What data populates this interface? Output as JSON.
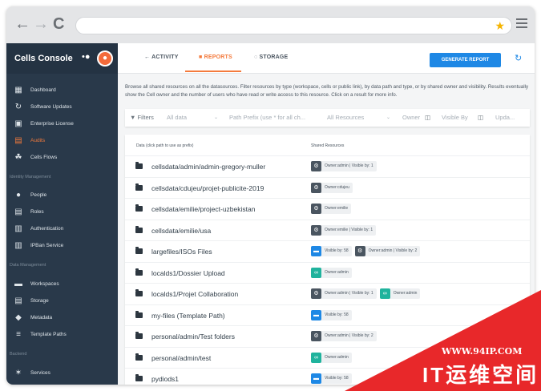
{
  "browser": {
    "back_icon": "arrow-left-icon",
    "forward_icon": "arrow-right-icon",
    "reload_icon": "reload-icon",
    "address_value": "",
    "star_icon": "star-icon",
    "menu_icon": "hamburger-icon",
    "back_glyph": "←",
    "forward_glyph": "→",
    "reload_glyph": "C",
    "star_glyph": "★"
  },
  "brand": {
    "name": "Cells Console",
    "dot": "•●"
  },
  "sidebar": {
    "items_top": [
      {
        "label": "Dashboard",
        "icon": "dashboard-icon",
        "glyph": "▦"
      },
      {
        "label": "Software Updates",
        "icon": "update-icon",
        "glyph": "↻"
      },
      {
        "label": "Enterprise License",
        "icon": "license-icon",
        "glyph": "▣"
      },
      {
        "label": "Audits",
        "icon": "audit-icon",
        "glyph": "▤",
        "active": true
      },
      {
        "label": "Cells Flows",
        "icon": "flows-icon",
        "glyph": "☘"
      }
    ],
    "section_identity": "Identity Management",
    "items_identity": [
      {
        "label": "People",
        "icon": "person-icon",
        "glyph": "●"
      },
      {
        "label": "Roles",
        "icon": "roles-icon",
        "glyph": "▤"
      },
      {
        "label": "Authentication",
        "icon": "authentication-icon",
        "glyph": "▥"
      },
      {
        "label": "IPBan Service",
        "icon": "ipban-icon",
        "glyph": "▥"
      }
    ],
    "section_data": "Data Management",
    "items_data": [
      {
        "label": "Workspaces",
        "icon": "folder-icon",
        "glyph": "▬"
      },
      {
        "label": "Storage",
        "icon": "storage-icon",
        "glyph": "▤"
      },
      {
        "label": "Metadata",
        "icon": "tag-icon",
        "glyph": "◆"
      },
      {
        "label": "Template Paths",
        "icon": "tree-icon",
        "glyph": "≡"
      }
    ],
    "section_backend": "Backend",
    "items_backend": [
      {
        "label": "Services",
        "icon": "services-icon",
        "glyph": "✶"
      }
    ]
  },
  "tabs": [
    {
      "label": "←  ACTIVITY",
      "active": false
    },
    {
      "label": "■  REPORTS",
      "active": true
    },
    {
      "label": "◌  STORAGE",
      "active": false
    }
  ],
  "generate_button": "GENERATE REPORT",
  "refresh_glyph": "↻",
  "description": "Browse all shared resources on all the datasources. Filter resources by type (workspace, cells or public link), by data path and type, or by shared owner and visibility. Results eventually show the Cell owner and the number of users who have read or write access to this resource. Click on a result for more info.",
  "filters": {
    "label": "▼ Filters",
    "data_select": "All data",
    "path_placeholder": "Path Prefix (use * for all ch...",
    "resources_select": "All Resources",
    "owner": "Owner",
    "visible_by": "Visible By",
    "update": "Upda..."
  },
  "table": {
    "headers": [
      "Data (click path to use as prefix)",
      "Shared Resources"
    ],
    "rows": [
      {
        "path": "cellsdata/admin/admin-gregory-muller",
        "badges": [
          {
            "type": "user",
            "text": "Owner:admin | Visible by: 1"
          }
        ]
      },
      {
        "path": "cellsdata/cdujeu/projet-publicite-2019",
        "badges": [
          {
            "type": "user",
            "text": "Owner:cdujeu"
          }
        ]
      },
      {
        "path": "cellsdata/emilie/project-uzbekistan",
        "badges": [
          {
            "type": "user",
            "text": "Owner:emilie"
          }
        ]
      },
      {
        "path": "cellsdata/emilie/usa",
        "badges": [
          {
            "type": "user",
            "text": "Owner:emilie | Visible by: 1"
          }
        ]
      },
      {
        "path": "largefiles/ISOs Files",
        "badges": [
          {
            "type": "ws",
            "text": "Visible by: 58"
          },
          {
            "type": "user",
            "text": "Owner:admin | Visible by: 2"
          }
        ]
      },
      {
        "path": "localds1/Dossier Upload",
        "badges": [
          {
            "type": "link",
            "text": "Owner:admin"
          }
        ]
      },
      {
        "path": "localds1/Projet Collaboration",
        "badges": [
          {
            "type": "user",
            "text": "Owner:admin | Visible by: 1"
          },
          {
            "type": "link",
            "text": "Owner:admin"
          }
        ]
      },
      {
        "path": "my-files (Template Path)",
        "badges": [
          {
            "type": "ws",
            "text": "Visible by: 58"
          }
        ]
      },
      {
        "path": "personal/admin/Test folders",
        "badges": [
          {
            "type": "user",
            "text": "Owner:admin | Visible by: 2"
          }
        ]
      },
      {
        "path": "personal/admin/test",
        "badges": [
          {
            "type": "link",
            "text": "Owner:admin"
          }
        ]
      },
      {
        "path": "pydiods1",
        "badges": [
          {
            "type": "ws",
            "text": "Visible by: 58"
          }
        ]
      }
    ]
  },
  "watermark": {
    "url": "WWW.94IP.COM",
    "text": "IT运维空间"
  },
  "colors": {
    "accent": "#f47a3c",
    "primary": "#1e88e5",
    "sidebar": "#29394a",
    "link_badge": "#20b39d"
  }
}
